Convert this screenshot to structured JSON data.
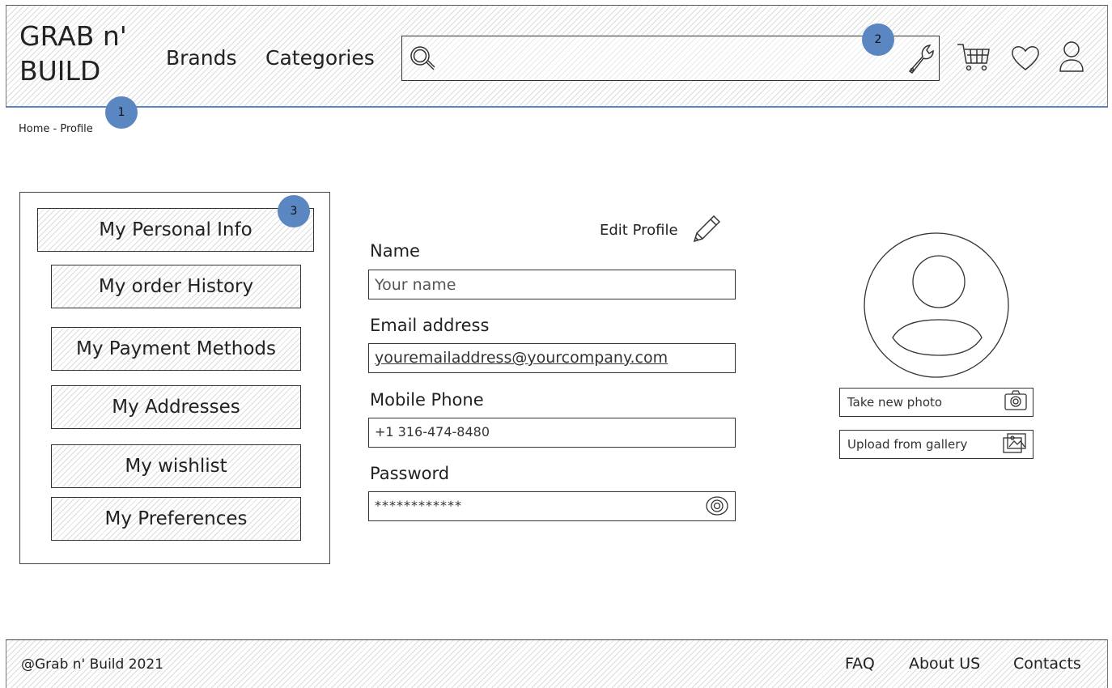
{
  "header": {
    "logo_line1": "GRAB n'",
    "logo_line2": "BUILD",
    "nav": {
      "brands": "Brands",
      "categories": "Categories"
    },
    "search": {
      "placeholder": ""
    },
    "icons": [
      "search-icon",
      "wrench-icon",
      "cart-icon",
      "heart-icon",
      "user-icon"
    ]
  },
  "badges": {
    "one": "1",
    "two": "2",
    "three": "3"
  },
  "breadcrumb": "Home - Profile",
  "sidebar": {
    "items": [
      {
        "label": "My Personal Info"
      },
      {
        "label": "My order History"
      },
      {
        "label": "My Payment Methods"
      },
      {
        "label": "My Addresses"
      },
      {
        "label": "My wishlist"
      },
      {
        "label": "My Preferences"
      }
    ]
  },
  "profile": {
    "edit_label": "Edit Profile",
    "name": {
      "label": "Name",
      "placeholder": "Your name"
    },
    "email": {
      "label": "Email address",
      "value": "youremailaddress@yourcompany.com"
    },
    "phone": {
      "label": "Mobile Phone",
      "value": "+1 316-474-8480"
    },
    "password": {
      "label": "Password",
      "value": "************"
    }
  },
  "photo": {
    "take_new": "Take new photo",
    "upload": "Upload from gallery"
  },
  "footer": {
    "copyright": "@Grab n' Build 2021",
    "links": {
      "faq": "FAQ",
      "about": "About US",
      "contacts": "Contacts"
    }
  },
  "colors": {
    "accent": "#5a86c2",
    "ink": "#222222",
    "hatch": "#dcdcdc"
  }
}
